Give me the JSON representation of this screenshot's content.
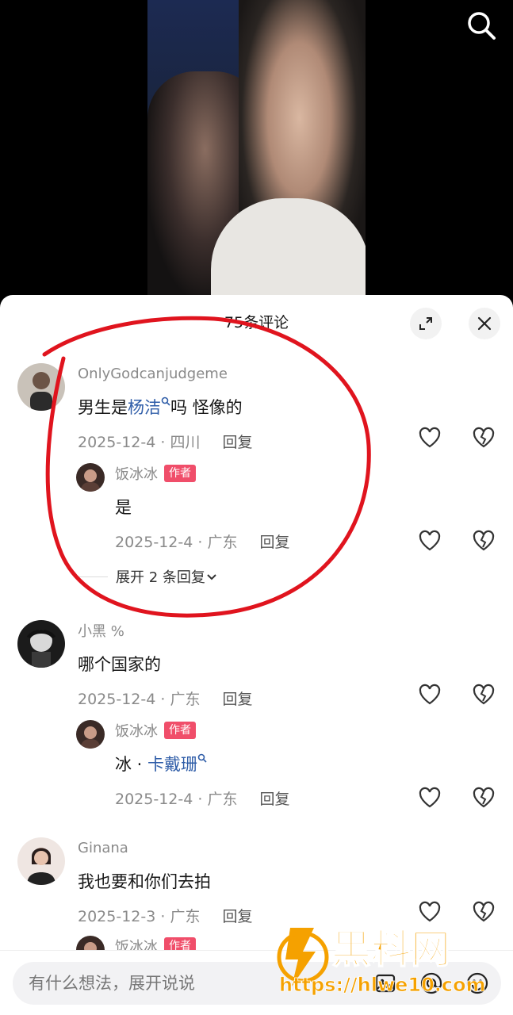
{
  "header": {
    "comment_count": "75条评论"
  },
  "comments": [
    {
      "username": "OnlyGodcanjudgeme",
      "text_before": "男生是",
      "link_text": "杨洁",
      "text_after": "吗 怪像的",
      "meta": "2025-12-4 · 四川",
      "reply_label": "回复",
      "reply": {
        "username": "饭冰冰",
        "badge": "作者",
        "text": "是",
        "meta": "2025-12-4 · 广东",
        "reply_label": "回复"
      },
      "expand_label": "展开 2 条回复"
    },
    {
      "username": "小黑 %",
      "text": "哪个国家的",
      "meta": "2025-12-4 · 广东",
      "reply_label": "回复",
      "reply": {
        "username": "饭冰冰",
        "badge": "作者",
        "text_before": "冰 · ",
        "link_text": "卡戴珊",
        "meta": "2025-12-4 · 广东",
        "reply_label": "回复"
      }
    },
    {
      "username": "Ginana",
      "text": "我也要和你们去拍",
      "meta": "2025-12-3 · 广东",
      "reply_label": "回复",
      "reply": {
        "username": "饭冰冰",
        "badge": "作者"
      }
    }
  ],
  "input": {
    "placeholder": "有什么想法，展开说说"
  },
  "watermark": {
    "brand": "黑料网",
    "url": "https://hlwe10.com"
  },
  "icons": {
    "search": "search-icon",
    "expand": "expand-icon",
    "close": "close-icon",
    "like": "heart-icon",
    "dislike": "broken-heart-icon",
    "image": "image-icon",
    "mention": "at-icon",
    "emoji": "emoji-icon"
  },
  "colors": {
    "author_badge": "#f04e6a",
    "link": "#2f5da8",
    "annotation": "#e0141e",
    "watermark": "#f5a100"
  }
}
